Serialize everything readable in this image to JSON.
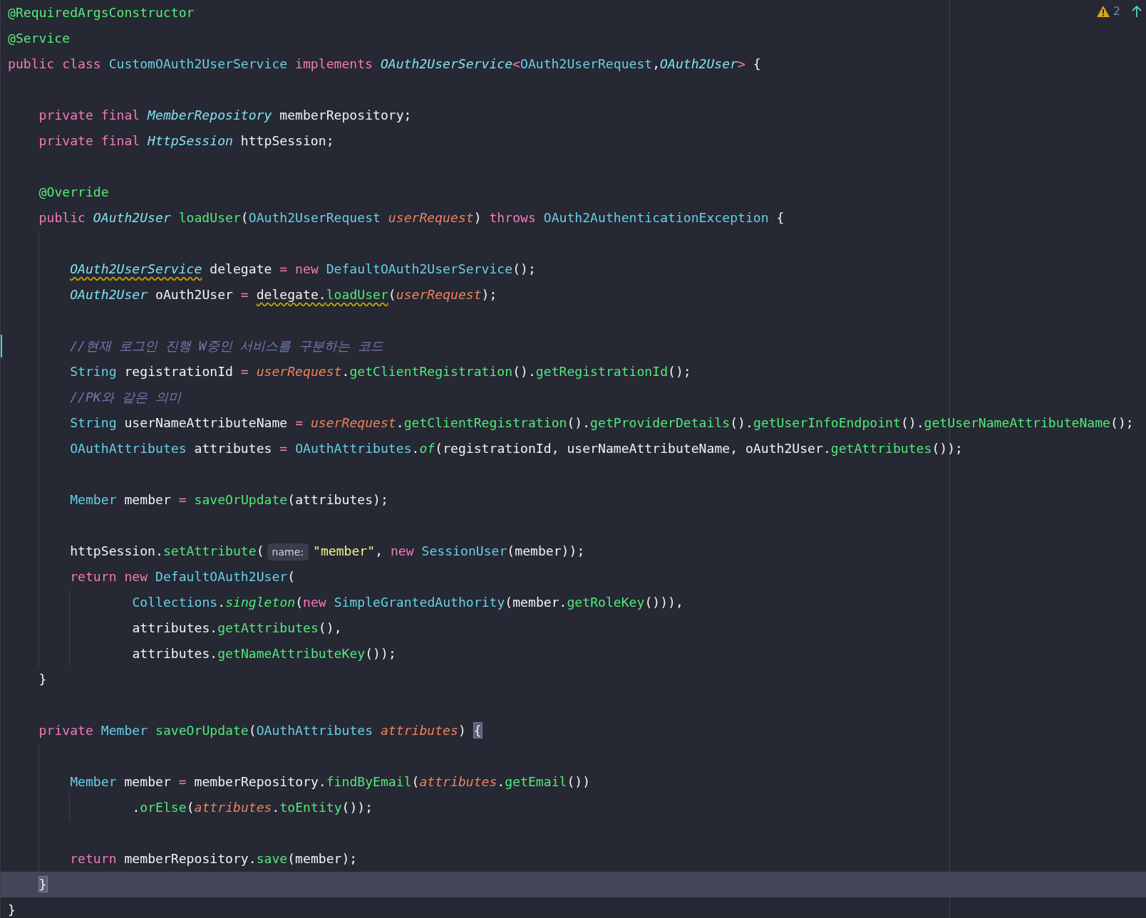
{
  "problems": {
    "count": "2"
  },
  "lines": [
    {
      "kind": "code",
      "current": false,
      "changed": false,
      "tokens": [
        {
          "kind": "ann",
          "t": "@RequiredArgsConstructor"
        }
      ]
    },
    {
      "kind": "code",
      "current": false,
      "changed": false,
      "tokens": [
        {
          "kind": "ann",
          "t": "@Service"
        }
      ]
    },
    {
      "kind": "code",
      "current": false,
      "changed": false,
      "tokens": [
        {
          "kind": "kw",
          "t": "public class "
        },
        {
          "kind": "type",
          "t": "CustomOAuth2UserService"
        },
        {
          "kind": "kw",
          "t": " implements "
        },
        {
          "kind": "itype",
          "t": "OAuth2UserService"
        },
        {
          "kind": "op",
          "t": "<"
        },
        {
          "kind": "type",
          "t": "OAuth2UserRequest"
        },
        {
          "kind": "text",
          "t": ","
        },
        {
          "kind": "itype",
          "t": "OAuth2User"
        },
        {
          "kind": "op",
          "t": ">"
        },
        {
          "kind": "text",
          "t": " {"
        }
      ],
      "children": [
        {
          "kind": "blank",
          "current": false,
          "changed": false
        },
        {
          "kind": "code",
          "current": false,
          "changed": false,
          "tokens": [
            {
              "kind": "kw",
              "t": "private final "
            },
            {
              "kind": "itype",
              "t": "MemberRepository"
            },
            {
              "kind": "text",
              "t": " memberRepository;"
            }
          ]
        },
        {
          "kind": "code",
          "current": false,
          "changed": false,
          "tokens": [
            {
              "kind": "kw",
              "t": "private final "
            },
            {
              "kind": "itype",
              "t": "HttpSession"
            },
            {
              "kind": "text",
              "t": " httpSession;"
            }
          ]
        },
        {
          "kind": "blank",
          "current": false,
          "changed": false
        },
        {
          "kind": "code",
          "current": false,
          "changed": false,
          "tokens": [
            {
              "kind": "ann",
              "t": "@Override"
            }
          ]
        },
        {
          "kind": "code",
          "current": false,
          "changed": false,
          "tokens": [
            {
              "kind": "kw",
              "t": "public "
            },
            {
              "kind": "itype",
              "t": "OAuth2User"
            },
            {
              "kind": "fn",
              "t": " loadUser"
            },
            {
              "kind": "text",
              "t": "("
            },
            {
              "kind": "type",
              "t": "OAuth2UserRequest "
            },
            {
              "kind": "param",
              "t": "userRequest"
            },
            {
              "kind": "text",
              "t": ") "
            },
            {
              "kind": "kw",
              "t": "throws "
            },
            {
              "kind": "type",
              "t": "OAuth2AuthenticationException"
            },
            {
              "kind": "text",
              "t": " {"
            }
          ],
          "children": [
            {
              "kind": "blank",
              "current": false,
              "changed": false
            },
            {
              "kind": "code",
              "current": false,
              "changed": false,
              "tokens": [
                {
                  "kind": "itype",
                  "t": "OAuth2UserService",
                  "warning": true
                },
                {
                  "kind": "text",
                  "t": " delegate "
                },
                {
                  "kind": "op",
                  "t": "= "
                },
                {
                  "kind": "kw",
                  "t": "new "
                },
                {
                  "kind": "type",
                  "t": "DefaultOAuth2UserService"
                },
                {
                  "kind": "text",
                  "t": "();"
                }
              ]
            },
            {
              "kind": "code",
              "current": false,
              "changed": false,
              "tokens": [
                {
                  "kind": "itype",
                  "t": "OAuth2User"
                },
                {
                  "kind": "text",
                  "t": " oAuth2User "
                },
                {
                  "kind": "op",
                  "t": "= "
                },
                {
                  "kind": "text",
                  "t": "delegate.",
                  "warning": true
                },
                {
                  "kind": "fn",
                  "t": "loadUser",
                  "warning": true
                },
                {
                  "kind": "text",
                  "t": "("
                },
                {
                  "kind": "param",
                  "t": "userRequest"
                },
                {
                  "kind": "text",
                  "t": ");"
                }
              ]
            },
            {
              "kind": "blank",
              "current": false,
              "changed": false
            },
            {
              "kind": "code",
              "current": false,
              "changed": true,
              "tokens": [
                {
                  "kind": "comment",
                  "t": "//현재 로그인 진행 W중인 서비스를 구분하는 코드"
                }
              ]
            },
            {
              "kind": "code",
              "current": false,
              "changed": false,
              "tokens": [
                {
                  "kind": "type",
                  "t": "String"
                },
                {
                  "kind": "text",
                  "t": " registrationId "
                },
                {
                  "kind": "op",
                  "t": "= "
                },
                {
                  "kind": "param",
                  "t": "userRequest"
                },
                {
                  "kind": "text",
                  "t": "."
                },
                {
                  "kind": "fn",
                  "t": "getClientRegistration"
                },
                {
                  "kind": "text",
                  "t": "()."
                },
                {
                  "kind": "fn",
                  "t": "getRegistrationId"
                },
                {
                  "kind": "text",
                  "t": "();"
                }
              ]
            },
            {
              "kind": "code",
              "current": false,
              "changed": false,
              "tokens": [
                {
                  "kind": "comment",
                  "t": "//PK와 같은 의미"
                }
              ]
            },
            {
              "kind": "code",
              "current": false,
              "changed": false,
              "tokens": [
                {
                  "kind": "type",
                  "t": "String"
                },
                {
                  "kind": "text",
                  "t": " userNameAttributeName "
                },
                {
                  "kind": "op",
                  "t": "= "
                },
                {
                  "kind": "param",
                  "t": "userRequest"
                },
                {
                  "kind": "text",
                  "t": "."
                },
                {
                  "kind": "fn",
                  "t": "getClientRegistration"
                },
                {
                  "kind": "text",
                  "t": "()."
                },
                {
                  "kind": "fn",
                  "t": "getProviderDetails"
                },
                {
                  "kind": "text",
                  "t": "()."
                },
                {
                  "kind": "fn",
                  "t": "getUserInfoEndpoint"
                },
                {
                  "kind": "text",
                  "t": "()."
                },
                {
                  "kind": "fn",
                  "t": "getUserNameAttributeName"
                },
                {
                  "kind": "text",
                  "t": "();"
                }
              ]
            },
            {
              "kind": "code",
              "current": false,
              "changed": false,
              "tokens": [
                {
                  "kind": "type",
                  "t": "OAuthAttributes"
                },
                {
                  "kind": "text",
                  "t": " attributes "
                },
                {
                  "kind": "op",
                  "t": "= "
                },
                {
                  "kind": "type",
                  "t": "OAuthAttributes"
                },
                {
                  "kind": "text",
                  "t": "."
                },
                {
                  "kind": "ifn",
                  "t": "of"
                },
                {
                  "kind": "text",
                  "t": "(registrationId, userNameAttributeName, oAuth2User."
                },
                {
                  "kind": "fn",
                  "t": "getAttributes"
                },
                {
                  "kind": "text",
                  "t": "());"
                }
              ]
            },
            {
              "kind": "blank",
              "current": false,
              "changed": false
            },
            {
              "kind": "code",
              "current": false,
              "changed": false,
              "tokens": [
                {
                  "kind": "type",
                  "t": "Member"
                },
                {
                  "kind": "text",
                  "t": " member "
                },
                {
                  "kind": "op",
                  "t": "= "
                },
                {
                  "kind": "fn",
                  "t": "saveOrUpdate"
                },
                {
                  "kind": "text",
                  "t": "(attributes);"
                }
              ]
            },
            {
              "kind": "blank",
              "current": false,
              "changed": false
            },
            {
              "kind": "code",
              "current": false,
              "changed": false,
              "tokens": [
                {
                  "kind": "text",
                  "t": "httpSession."
                },
                {
                  "kind": "fn",
                  "t": "setAttribute"
                },
                {
                  "kind": "text",
                  "t": "("
                },
                {
                  "kind": "hint",
                  "t": "name:"
                },
                {
                  "kind": "str",
                  "t": "\"member\""
                },
                {
                  "kind": "text",
                  "t": ", "
                },
                {
                  "kind": "kw",
                  "t": "new "
                },
                {
                  "kind": "type",
                  "t": "SessionUser"
                },
                {
                  "kind": "text",
                  "t": "(member));"
                }
              ]
            },
            {
              "kind": "code",
              "current": false,
              "changed": false,
              "tokens": [
                {
                  "kind": "kw",
                  "t": "return new "
                },
                {
                  "kind": "type",
                  "t": "DefaultOAuth2User"
                },
                {
                  "kind": "text",
                  "t": "("
                }
              ],
              "children": [
                {
                  "kind": "wrapped",
                  "current": false,
                  "changed": false,
                  "tokens": [
                    {
                      "kind": "type",
                      "t": "Collections"
                    },
                    {
                      "kind": "text",
                      "t": "."
                    },
                    {
                      "kind": "ifn",
                      "t": "singleton"
                    },
                    {
                      "kind": "text",
                      "t": "("
                    },
                    {
                      "kind": "kw",
                      "t": "new "
                    },
                    {
                      "kind": "type",
                      "t": "SimpleGrantedAuthority"
                    },
                    {
                      "kind": "text",
                      "t": "(member."
                    },
                    {
                      "kind": "fn",
                      "t": "getRoleKey"
                    },
                    {
                      "kind": "text",
                      "t": "())),"
                    }
                  ]
                },
                {
                  "kind": "wrapped",
                  "current": false,
                  "changed": false,
                  "tokens": [
                    {
                      "kind": "text",
                      "t": "attributes."
                    },
                    {
                      "kind": "fn",
                      "t": "getAttributes"
                    },
                    {
                      "kind": "text",
                      "t": "(),"
                    }
                  ]
                },
                {
                  "kind": "wrapped",
                  "current": false,
                  "changed": false,
                  "tokens": [
                    {
                      "kind": "text",
                      "t": "attributes."
                    },
                    {
                      "kind": "fn",
                      "t": "getNameAttributeKey"
                    },
                    {
                      "kind": "text",
                      "t": "());"
                    }
                  ]
                }
              ]
            }
          ]
        },
        {
          "kind": "code",
          "current": false,
          "changed": false,
          "tokens": [
            {
              "kind": "text",
              "t": "}"
            }
          ]
        },
        {
          "kind": "blank",
          "current": false,
          "changed": false
        },
        {
          "kind": "code",
          "current": false,
          "changed": false,
          "tokens": [
            {
              "kind": "kw",
              "t": "private "
            },
            {
              "kind": "type",
              "t": "Member "
            },
            {
              "kind": "fn",
              "t": "saveOrUpdate"
            },
            {
              "kind": "text",
              "t": "("
            },
            {
              "kind": "type",
              "t": "OAuthAttributes "
            },
            {
              "kind": "param",
              "t": "attributes"
            },
            {
              "kind": "text",
              "t": ") "
            },
            {
              "kind": "text",
              "t": "{",
              "matched": true
            }
          ],
          "children": [
            {
              "kind": "blank",
              "current": false,
              "changed": false
            },
            {
              "kind": "code",
              "current": false,
              "changed": false,
              "tokens": [
                {
                  "kind": "type",
                  "t": "Member"
                },
                {
                  "kind": "text",
                  "t": " member "
                },
                {
                  "kind": "op",
                  "t": "= "
                },
                {
                  "kind": "text",
                  "t": "memberRepository."
                },
                {
                  "kind": "fn",
                  "t": "findByEmail"
                },
                {
                  "kind": "text",
                  "t": "("
                },
                {
                  "kind": "param",
                  "t": "attributes"
                },
                {
                  "kind": "text",
                  "t": "."
                },
                {
                  "kind": "fn",
                  "t": "getEmail"
                },
                {
                  "kind": "text",
                  "t": "())"
                }
              ],
              "children": [
                {
                  "kind": "wrapped",
                  "current": false,
                  "changed": false,
                  "tokens": [
                    {
                      "kind": "text",
                      "t": "."
                    },
                    {
                      "kind": "fn",
                      "t": "orElse"
                    },
                    {
                      "kind": "text",
                      "t": "("
                    },
                    {
                      "kind": "param",
                      "t": "attributes"
                    },
                    {
                      "kind": "text",
                      "t": "."
                    },
                    {
                      "kind": "fn",
                      "t": "toEntity"
                    },
                    {
                      "kind": "text",
                      "t": "());"
                    }
                  ]
                }
              ]
            },
            {
              "kind": "blank",
              "current": false,
              "changed": false
            },
            {
              "kind": "code",
              "current": false,
              "changed": false,
              "tokens": [
                {
                  "kind": "kw",
                  "t": "return "
                },
                {
                  "kind": "text",
                  "t": "memberRepository."
                },
                {
                  "kind": "fn",
                  "t": "save"
                },
                {
                  "kind": "text",
                  "t": "(member);"
                }
              ]
            }
          ]
        },
        {
          "kind": "code",
          "current": true,
          "changed": false,
          "tokens": [
            {
              "kind": "text",
              "t": "}",
              "matched": true
            }
          ]
        }
      ]
    },
    {
      "kind": "code",
      "current": false,
      "changed": false,
      "tokens": [
        {
          "kind": "text",
          "t": "}"
        }
      ]
    }
  ]
}
